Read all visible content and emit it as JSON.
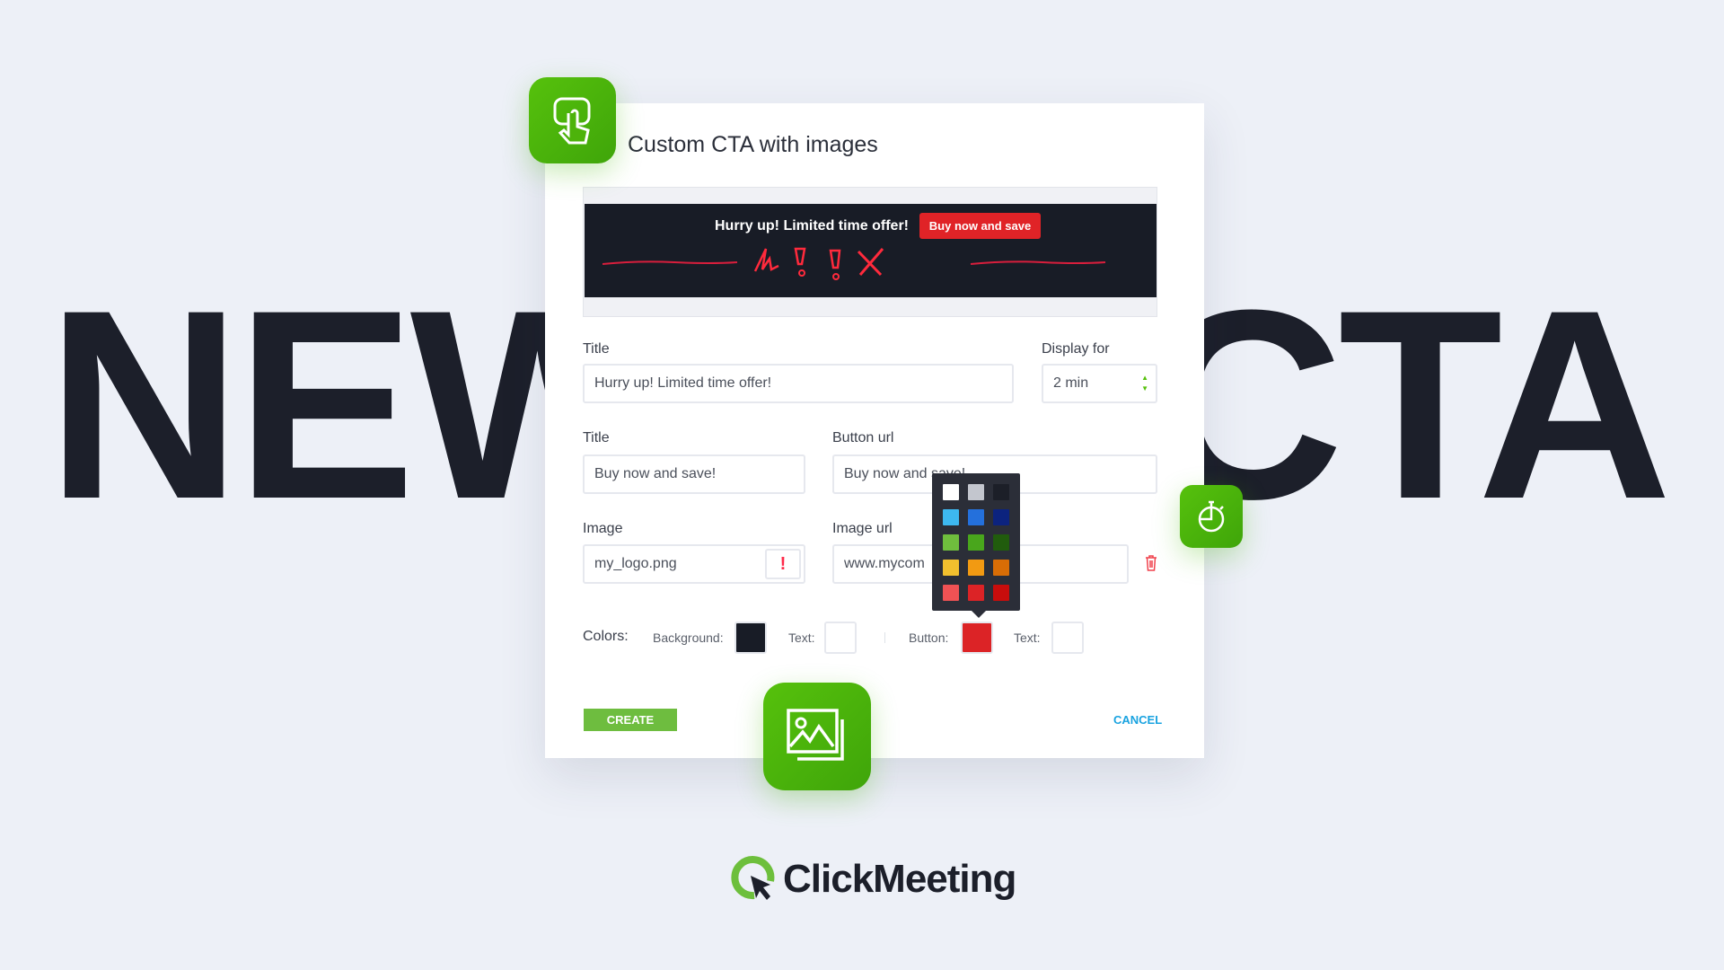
{
  "background_text": {
    "left": "NEW",
    "right": "CTA"
  },
  "dialog": {
    "title": "Custom CTA with images",
    "preview": {
      "headline": "Hurry up! Limited time offer!",
      "button": "Buy now and save"
    },
    "fields": {
      "title_label": "Title",
      "title_value": "Hurry up! Limited time offer!",
      "display_label": "Display for",
      "display_value": "2 min",
      "button_title_label": "Title",
      "button_title_value": "Buy now and save!",
      "button_url_label": "Button url",
      "button_url_value": "Buy now and save!",
      "image_label": "Image",
      "image_value": "my_logo.png",
      "image_url_label": "Image url",
      "image_url_value": "www.mycom"
    },
    "colors": {
      "label": "Colors:",
      "background_label": "Background:",
      "text_label": "Text:",
      "button_label": "Button:",
      "button_text_label": "Text:",
      "background": "#181c26",
      "text": "#ffffff",
      "button": "#dc2326",
      "button_text": "#ffffff"
    },
    "palette": [
      "#ffffff",
      "#c3c6ce",
      "#1c1f28",
      "#3db8f0",
      "#2470dc",
      "#0c237e",
      "#6fbe3d",
      "#49a61c",
      "#215c0d",
      "#f2c02e",
      "#f29a12",
      "#d86d06",
      "#f05254",
      "#dc2326",
      "#c80d0c"
    ],
    "create": "CREATE",
    "cancel": "CANCEL"
  },
  "brand": {
    "name": "ClickMeeting",
    "accent": "#56c10c"
  }
}
